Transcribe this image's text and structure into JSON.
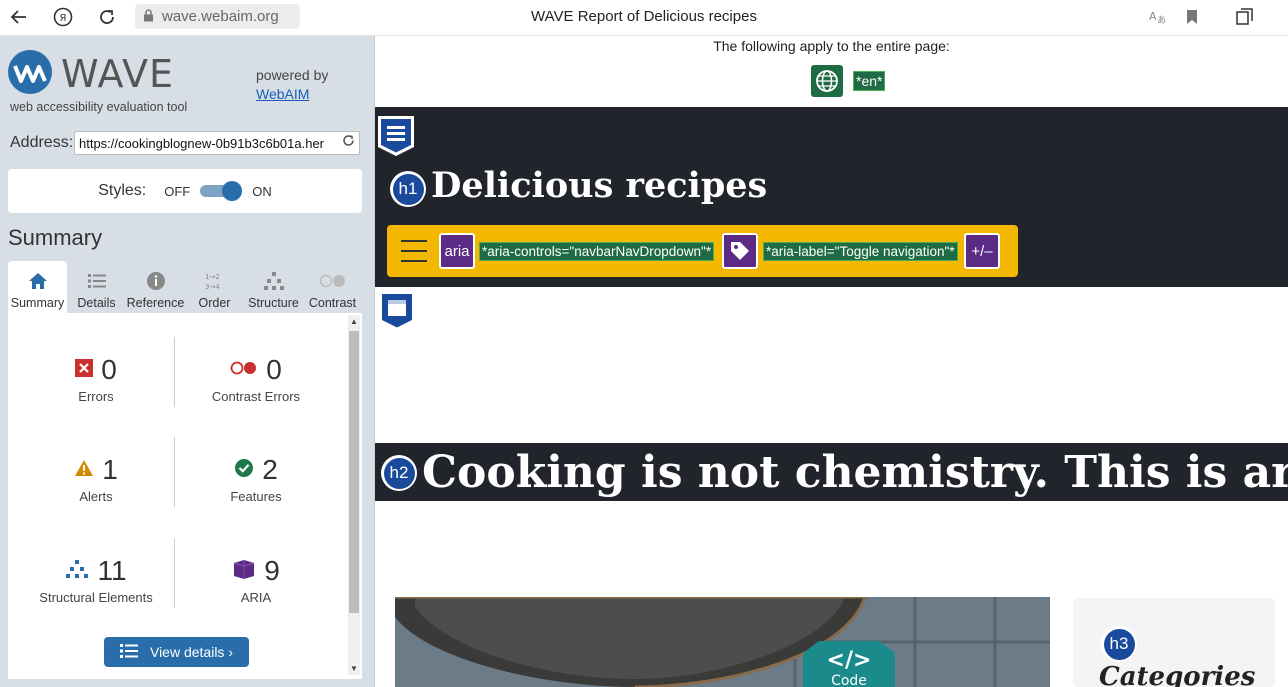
{
  "browser": {
    "address": "wave.webaim.org",
    "window_title": "WAVE Report of Delicious recipes"
  },
  "wave": {
    "logo_text": "WAVE",
    "tagline": "web accessibility evaluation tool",
    "powered_by": "powered by",
    "webaim_link": "WebAIM",
    "address_label": "Address:",
    "address_value": "https://cookingblognew-0b91b3c6b01a.her",
    "styles_label": "Styles:",
    "styles_off": "OFF",
    "styles_on": "ON",
    "styles_state": "ON",
    "summary_heading": "Summary",
    "tabs": [
      {
        "label": "Summary",
        "icon": "home-icon"
      },
      {
        "label": "Details",
        "icon": "list-icon"
      },
      {
        "label": "Reference",
        "icon": "info-icon"
      },
      {
        "label": "Order",
        "icon": "order-icon"
      },
      {
        "label": "Structure",
        "icon": "structure-icon"
      },
      {
        "label": "Contrast",
        "icon": "contrast-icon"
      }
    ],
    "active_tab": "Summary",
    "stats": {
      "errors": {
        "count": "0",
        "label": "Errors"
      },
      "contrast_errors": {
        "count": "0",
        "label": "Contrast Errors"
      },
      "alerts": {
        "count": "1",
        "label": "Alerts"
      },
      "features": {
        "count": "2",
        "label": "Features"
      },
      "structural": {
        "count": "11",
        "label": "Structural Elements"
      },
      "aria": {
        "count": "9",
        "label": "ARIA"
      }
    },
    "view_details": "View details ›"
  },
  "page": {
    "apply_text": "The following apply to the entire page:",
    "lang_tag": "*en*",
    "site_title": "Delicious recipes",
    "h1_badge": "h1",
    "h2_badge": "h2",
    "h3_badge": "h3",
    "aria_badge": "aria",
    "aria_controls": "*aria-controls=\"navbarNavDropdown\"*",
    "aria_label": "*aria-label=\"Toggle navigation\"*",
    "expand_badge": "+/–",
    "headline": "Cooking is not chemistry. This is art",
    "code_label": "Code",
    "sidebar_heading": "Categories"
  },
  "colors": {
    "wave_blue": "#2a6dab",
    "dark_band": "#21252b",
    "navbar_yellow": "#f5b800",
    "aria_purple": "#5b2b85",
    "feature_green": "#1f6b43",
    "error_red": "#c8302e",
    "alert_orange": "#d48a00"
  }
}
